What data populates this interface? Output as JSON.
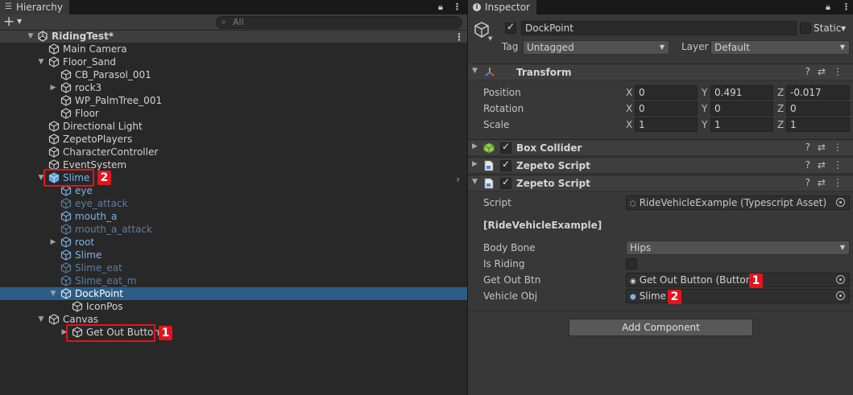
{
  "hierarchy": {
    "tab_label": "Hierarchy",
    "search_placeholder": "All",
    "add_label": "+",
    "scene_name": "RidingTest*",
    "items": [
      {
        "label": "Main Camera",
        "style": "normal"
      },
      {
        "label": "Floor_Sand",
        "style": "normal"
      },
      {
        "label": "CB_Parasol_001",
        "style": "normal"
      },
      {
        "label": "rock3",
        "style": "normal"
      },
      {
        "label": "WP_PalmTree_001",
        "style": "normal"
      },
      {
        "label": "Floor",
        "style": "normal"
      },
      {
        "label": "Directional Light",
        "style": "normal"
      },
      {
        "label": "ZepetoPlayers",
        "style": "normal"
      },
      {
        "label": "CharacterController",
        "style": "normal"
      },
      {
        "label": "EventSystem",
        "style": "normal"
      },
      {
        "label": "Slime",
        "style": "prefab"
      },
      {
        "label": "eye",
        "style": "prefab"
      },
      {
        "label": "eye_attack",
        "style": "prefab-inactive"
      },
      {
        "label": "mouth_a",
        "style": "prefab"
      },
      {
        "label": "mouth_a_attack",
        "style": "prefab-inactive"
      },
      {
        "label": "root",
        "style": "prefab"
      },
      {
        "label": "Slime",
        "style": "prefab"
      },
      {
        "label": "Slime_eat",
        "style": "prefab-inactive"
      },
      {
        "label": "Slime_eat_m",
        "style": "prefab-inactive"
      },
      {
        "label": "DockPoint",
        "style": "selected"
      },
      {
        "label": "IconPos",
        "style": "normal"
      },
      {
        "label": "Canvas",
        "style": "normal"
      },
      {
        "label": "Get Out Button",
        "style": "normal"
      }
    ]
  },
  "markers": {
    "one": "1",
    "two": "2"
  },
  "inspector": {
    "tab_label": "Inspector",
    "object_name": "DockPoint",
    "static_label": "Static",
    "tag_label": "Tag",
    "tag_value": "Untagged",
    "layer_label": "Layer",
    "layer_value": "Default",
    "transform": {
      "title": "Transform",
      "rows": [
        {
          "label": "Position",
          "x": "0",
          "y": "0.491",
          "z": "-0.017"
        },
        {
          "label": "Rotation",
          "x": "0",
          "y": "0",
          "z": "0"
        },
        {
          "label": "Scale",
          "x": "1",
          "y": "1",
          "z": "1"
        }
      ],
      "axis_x": "X",
      "axis_y": "Y",
      "axis_z": "Z"
    },
    "box_collider": {
      "title": "Box Collider"
    },
    "zepeto_script_1": {
      "title": "Zepeto Script"
    },
    "zepeto_script_2": {
      "title": "Zepeto Script",
      "script_label": "Script",
      "script_value": "RideVehicleExample (Typescript Asset)",
      "section_header": "[RideVehicleExample]",
      "body_bone_label": "Body Bone",
      "body_bone_value": "Hips",
      "is_riding_label": "Is Riding",
      "is_riding_checked": false,
      "get_out_btn_label": "Get Out Btn",
      "get_out_btn_value": "Get Out Button (Button)",
      "vehicle_obj_label": "Vehicle Obj",
      "vehicle_obj_value": "Slime"
    },
    "add_component_label": "Add Component"
  },
  "colors": {
    "selection": "#2c5d87",
    "prefab_text": "#7db3ec",
    "marker_red": "#e4141b"
  }
}
